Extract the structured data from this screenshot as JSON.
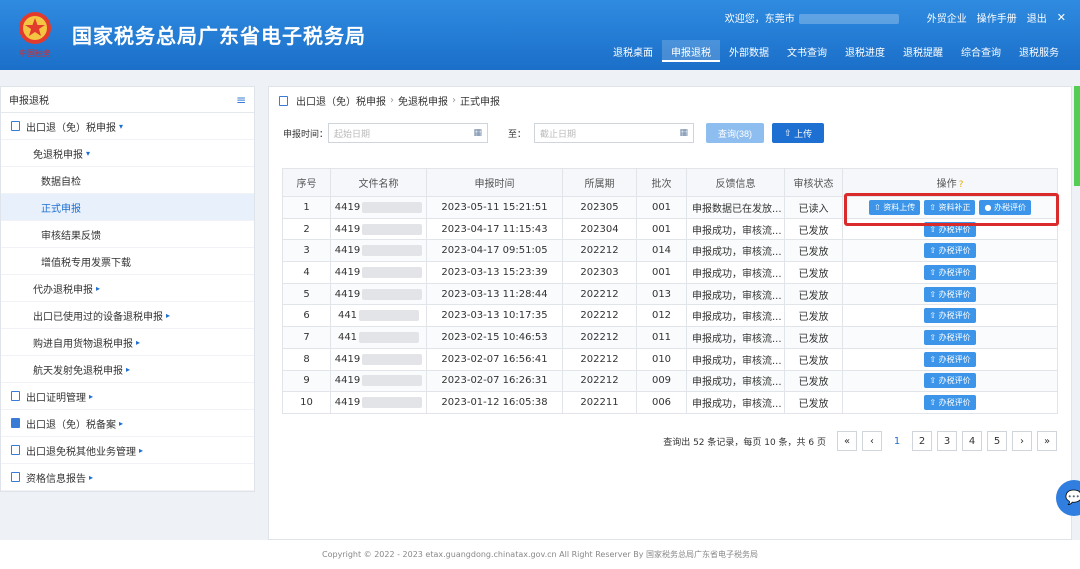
{
  "header": {
    "brand": "国家税务总局广东省电子税务局",
    "emblem_text": "中国税务",
    "welcome": "欢迎您，东莞市",
    "links": [
      "外贸企业",
      "操作手册",
      "退出"
    ],
    "close_icon": "close-icon",
    "nav": [
      "退税桌面",
      "申报退税",
      "外部数据",
      "文书查询",
      "退税进度",
      "退税提醒",
      "综合查询",
      "退税服务"
    ],
    "nav_active": "申报退税"
  },
  "sidebar": {
    "title": "申报退税",
    "menu_icon": "menu-icon",
    "items": [
      {
        "label": "出口退（免）税申报",
        "level": 1,
        "icon": "document-icon",
        "caret": "▾"
      },
      {
        "label": "免退税申报",
        "level": 2,
        "caret": "▾"
      },
      {
        "label": "数据自检",
        "level": 3
      },
      {
        "label": "正式申报",
        "level": 3,
        "active": true
      },
      {
        "label": "审核结果反馈",
        "level": 3
      },
      {
        "label": "增值税专用发票下载",
        "level": 3
      },
      {
        "label": "代办退税申报",
        "level": 2,
        "caret": "▸"
      },
      {
        "label": "出口已使用过的设备退税申报",
        "level": 2,
        "caret": "▸"
      },
      {
        "label": "购进自用货物退税申报",
        "level": 2,
        "caret": "▸"
      },
      {
        "label": "航天发射免退税申报",
        "level": 2,
        "caret": "▸"
      },
      {
        "label": "出口证明管理",
        "level": 1,
        "icon": "document-icon",
        "caret": "▸"
      },
      {
        "label": "出口退（免）税备案",
        "level": 1,
        "icon": "book-icon",
        "caret": "▸"
      },
      {
        "label": "出口退免税其他业务管理",
        "level": 1,
        "icon": "card-icon",
        "caret": "▸"
      },
      {
        "label": "资格信息报告",
        "level": 1,
        "icon": "document-icon",
        "caret": "▸"
      }
    ]
  },
  "breadcrumb": [
    "出口退（免）税申报",
    "免退税申报",
    "正式申报"
  ],
  "filter": {
    "label": "申报时间：",
    "start_placeholder": "起始日期",
    "to_label": "至：",
    "end_placeholder": "截止日期",
    "query_button": "查询(38)",
    "upload_button": "上传"
  },
  "table": {
    "headers": [
      "序号",
      "文件名称",
      "申报时间",
      "所属期",
      "批次",
      "反馈信息",
      "审核状态",
      "操作"
    ],
    "rows": [
      {
        "no": "1",
        "file": "4419",
        "time": "2023-05-11 15:21:51",
        "period": "202305",
        "batch": "001",
        "feedback": "申报数据已在发放...",
        "status": "已读入",
        "ops": [
          "资料上传",
          "资料补正",
          "办税评价"
        ]
      },
      {
        "no": "2",
        "file": "4419",
        "time": "2023-04-17 11:15:43",
        "period": "202304",
        "batch": "001",
        "feedback": "申报成功，审核流...",
        "status": "已发放",
        "ops": [
          "办税评价"
        ]
      },
      {
        "no": "3",
        "file": "4419",
        "time": "2023-04-17 09:51:05",
        "period": "202212",
        "batch": "014",
        "feedback": "申报成功，审核流...",
        "status": "已发放",
        "ops": [
          "办税评价"
        ]
      },
      {
        "no": "4",
        "file": "4419",
        "time": "2023-03-13 15:23:39",
        "period": "202303",
        "batch": "001",
        "feedback": "申报成功，审核流...",
        "status": "已发放",
        "ops": [
          "办税评价"
        ]
      },
      {
        "no": "5",
        "file": "4419",
        "time": "2023-03-13 11:28:44",
        "period": "202212",
        "batch": "013",
        "feedback": "申报成功，审核流...",
        "status": "已发放",
        "ops": [
          "办税评价"
        ]
      },
      {
        "no": "6",
        "file": "441",
        "time": "2023-03-13 10:17:35",
        "period": "202212",
        "batch": "012",
        "feedback": "申报成功，审核流...",
        "status": "已发放",
        "ops": [
          "办税评价"
        ]
      },
      {
        "no": "7",
        "file": "441",
        "time": "2023-02-15 10:46:53",
        "period": "202212",
        "batch": "011",
        "feedback": "申报成功，审核流...",
        "status": "已发放",
        "ops": [
          "办税评价"
        ]
      },
      {
        "no": "8",
        "file": "4419",
        "time": "2023-02-07 16:56:41",
        "period": "202212",
        "batch": "010",
        "feedback": "申报成功，审核流...",
        "status": "已发放",
        "ops": [
          "办税评价"
        ]
      },
      {
        "no": "9",
        "file": "4419",
        "time": "2023-02-07 16:26:31",
        "period": "202212",
        "batch": "009",
        "feedback": "申报成功，审核流...",
        "status": "已发放",
        "ops": [
          "办税评价"
        ]
      },
      {
        "no": "10",
        "file": "4419",
        "time": "2023-01-12 16:05:38",
        "period": "202211",
        "batch": "006",
        "feedback": "申报成功，审核流...",
        "status": "已发放",
        "ops": [
          "办税评价"
        ]
      }
    ]
  },
  "pagination": {
    "summary": "查询出 52 条记录，每页 10 条，共 6 页",
    "pages": [
      "1",
      "2",
      "3",
      "4",
      "5"
    ],
    "current": "1",
    "first": "«",
    "prev": "‹",
    "next": "›",
    "last": "»"
  },
  "footer": "Copyright © 2022 - 2023 etax.guangdong.chinatax.gov.cn All Right Reserver By 国家税务总局广东省电子税务局",
  "colors": {
    "header": "#1b6fc9",
    "accent": "#1d6fd1",
    "highlight": "#d92b2b",
    "op_button": "#3c95e8"
  }
}
